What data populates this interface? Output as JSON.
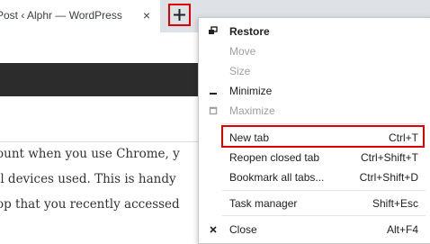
{
  "tab": {
    "title": "Post ‹ Alphr — WordPress",
    "close_glyph": "×"
  },
  "new_tab_button": {
    "icon": "plus-icon",
    "highlight_color": "#e00000"
  },
  "article": {
    "lines": [
      "ount when you use Chrome, y",
      "ll devices used. This is handy",
      "op that you recently accessed"
    ]
  },
  "menu": {
    "items": [
      {
        "label": "Restore",
        "icon": "restore-icon",
        "disabled": false,
        "bold": true,
        "shortcut": ""
      },
      {
        "label": "Move",
        "icon": "",
        "disabled": true,
        "bold": false,
        "shortcut": ""
      },
      {
        "label": "Size",
        "icon": "",
        "disabled": true,
        "bold": false,
        "shortcut": ""
      },
      {
        "label": "Minimize",
        "icon": "minimize-icon",
        "disabled": false,
        "bold": false,
        "shortcut": ""
      },
      {
        "label": "Maximize",
        "icon": "maximize-icon",
        "disabled": true,
        "bold": false,
        "shortcut": ""
      },
      {
        "label": "New tab",
        "icon": "",
        "disabled": false,
        "bold": false,
        "shortcut": "Ctrl+T"
      },
      {
        "label": "Reopen closed tab",
        "icon": "",
        "disabled": false,
        "bold": false,
        "shortcut": "Ctrl+Shift+T"
      },
      {
        "label": "Bookmark all tabs...",
        "icon": "",
        "disabled": false,
        "bold": false,
        "shortcut": "Ctrl+Shift+D"
      },
      {
        "label": "Task manager",
        "icon": "",
        "disabled": false,
        "bold": false,
        "shortcut": "Shift+Esc"
      },
      {
        "label": "Close",
        "icon": "close-icon",
        "disabled": false,
        "bold": false,
        "shortcut": "Alt+F4"
      }
    ]
  }
}
